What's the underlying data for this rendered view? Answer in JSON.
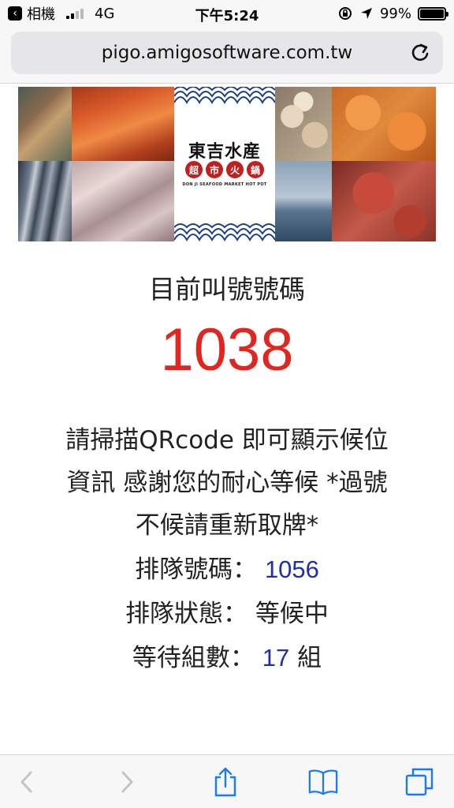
{
  "status_bar": {
    "back_app": "相機",
    "network": "4G",
    "time": "下午5:24",
    "battery": "99%",
    "battery_level": 0.99
  },
  "browser": {
    "url": "pigo.amigosoftware.com.tw"
  },
  "banner": {
    "logo_title": "東吉水産",
    "seal_chars": [
      "超",
      "市",
      "火",
      "鍋"
    ],
    "logo_english": "DON JI SEAFOOD MARKET HOT POT"
  },
  "queue": {
    "current_label": "目前叫號號碼",
    "current_number": "1038",
    "message_line1": "請掃描QRcode 即可顯示候位",
    "message_line2": "資訊 感謝您的耐心等候 *過號",
    "message_line3": "不候請重新取牌*",
    "number_label": "排隊號碼：",
    "number_value": "1056",
    "status_label": "排隊狀態：",
    "status_value": "等候中",
    "groups_label": "等待組數：",
    "groups_value": "17",
    "groups_unit": "組"
  },
  "colors": {
    "accent_red": "#e0261f",
    "accent_blue": "#1f2fa8",
    "ios_blue": "#1a7cf5"
  },
  "icons": {
    "back": "back-arrow-icon",
    "forward": "forward-arrow-icon",
    "share": "share-icon",
    "bookmarks": "bookmarks-book-icon",
    "tabs": "tabs-icon",
    "reload": "reload-icon"
  }
}
